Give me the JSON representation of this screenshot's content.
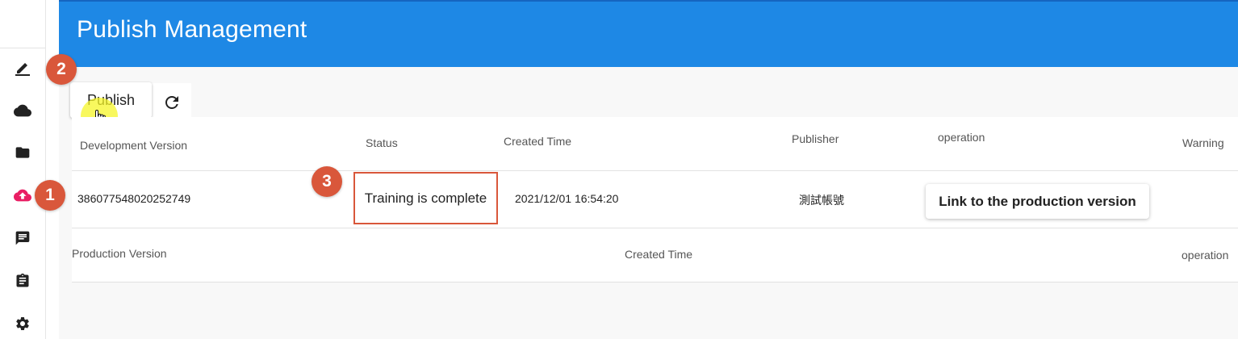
{
  "header": {
    "title": "Publish Management"
  },
  "sidebar": {
    "items": [
      {
        "icon": "edit-icon",
        "active": false
      },
      {
        "icon": "cloud-icon",
        "active": false
      },
      {
        "icon": "folder-icon",
        "active": false
      },
      {
        "icon": "cloud-upload-icon",
        "active": true
      },
      {
        "icon": "chat-icon",
        "active": false
      },
      {
        "icon": "clipboard-icon",
        "active": false
      },
      {
        "icon": "settings-icon",
        "active": false
      }
    ]
  },
  "annotations": {
    "step1": "1",
    "step2": "2",
    "step3": "3"
  },
  "toolbar": {
    "publish_label": "Publish",
    "refresh_icon": "refresh-icon"
  },
  "development_table": {
    "headers": {
      "version": "Development Version",
      "status": "Status",
      "created_time": "Created Time",
      "publisher": "Publisher",
      "operation": "operation",
      "warning": "Warning"
    },
    "rows": [
      {
        "version": "386077548020252749",
        "status": "Training is complete",
        "created_time": "2021/12/01 16:54:20",
        "publisher": "測試帳號",
        "operation_label": "Link to the production version"
      }
    ]
  },
  "production_table": {
    "headers": {
      "version": "Production Version",
      "created_time": "Created Time",
      "operation": "operation"
    }
  },
  "colors": {
    "header": "#1e88e5",
    "accent": "#d9573b",
    "active_icon": "#e91e63"
  }
}
